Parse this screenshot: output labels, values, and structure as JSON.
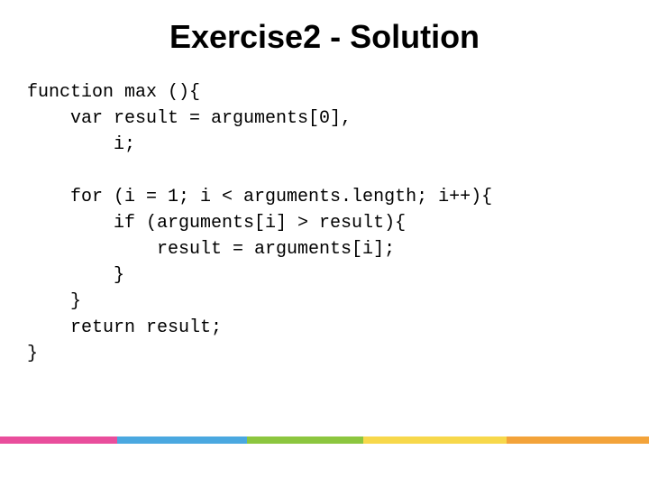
{
  "title": "Exercise2 - Solution",
  "code": "function max (){\n    var result = arguments[0],\n        i;\n\n    for (i = 1; i < arguments.length; i++){\n        if (arguments[i] > result){\n            result = arguments[i];\n        }\n    }\n    return result;\n}",
  "stripe_colors": {
    "pink": "#e94e9c",
    "blue": "#4aa8e0",
    "green": "#8cc63f",
    "yellow": "#f7d84b",
    "orange": "#f3a33a"
  }
}
